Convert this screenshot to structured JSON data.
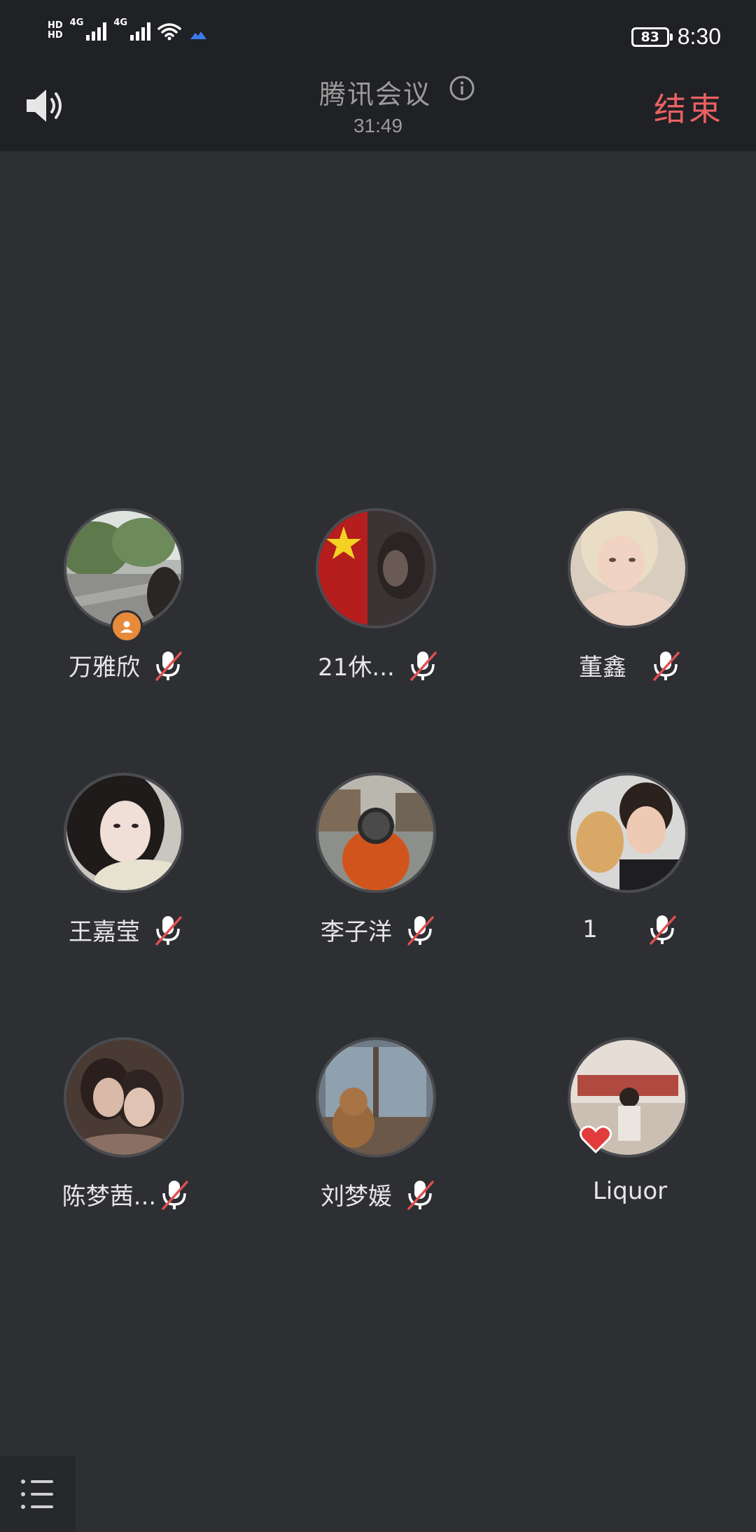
{
  "status_bar": {
    "hd_top": "HD",
    "hd_bottom": "HD",
    "network_1": "4G",
    "network_2": "4G",
    "battery": "83",
    "time": "8:30"
  },
  "header": {
    "title": "腾讯会议",
    "timer": "31:49",
    "end_label": "结束",
    "accent": "#e96163"
  },
  "participants": [
    {
      "name": "万雅欣",
      "muted": true,
      "host": true
    },
    {
      "name": "21休...",
      "muted": true
    },
    {
      "name": "董鑫",
      "muted": true
    },
    {
      "name": "王嘉莹",
      "muted": true
    },
    {
      "name": "李子洋",
      "muted": true
    },
    {
      "name": "1",
      "muted": true
    },
    {
      "name": "陈梦茜...",
      "muted": true
    },
    {
      "name": "刘梦媛",
      "muted": true
    },
    {
      "name": "Liquor",
      "muted": false
    }
  ],
  "icons": {
    "speaker": "speaker-icon",
    "info": "info-icon",
    "mic_muted": "mic-muted-icon",
    "host": "host-badge-icon",
    "list": "list-icon"
  }
}
